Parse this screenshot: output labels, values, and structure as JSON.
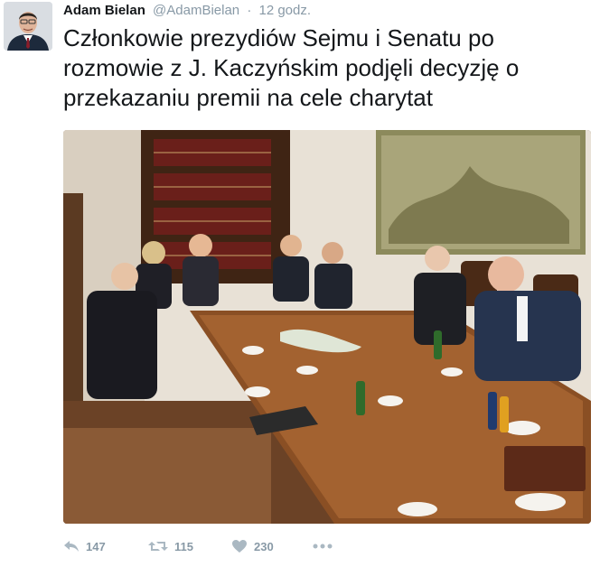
{
  "tweet": {
    "author_name": "Adam Bielan",
    "author_handle": "@AdamBielan",
    "separator": "·",
    "time": "12 godz.",
    "text": "Członkowie prezydiów Sejmu i Senatu po rozmowie z J. Kaczyńskim podjęli decyzję o przekazaniu premii na cele charytat",
    "avatar_icon": "profile-photo",
    "media_description_icon": "attached-photo",
    "actions": {
      "reply_icon": "reply-icon",
      "reply_count": "147",
      "retweet_icon": "retweet-icon",
      "retweet_count": "115",
      "like_icon": "heart-icon",
      "like_count": "230",
      "more_icon": "more-icon"
    },
    "colors": {
      "text": "#14171a",
      "meta": "#8899a6",
      "icon": "#aab8c2"
    }
  }
}
